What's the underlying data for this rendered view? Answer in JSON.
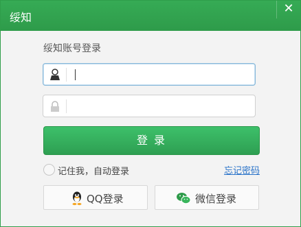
{
  "window": {
    "title": "绥知",
    "close_label": "✕"
  },
  "form": {
    "heading": "绥知账号登录",
    "username": {
      "value": "",
      "placeholder": ""
    },
    "password": {
      "value": "",
      "placeholder": ""
    },
    "login_label": "登 录",
    "remember_label": "记住我，自动登录",
    "forgot_label": "忘记密码"
  },
  "social": {
    "qq_label": "QQ登录",
    "wechat_label": "微信登录"
  },
  "colors": {
    "brand_green": "#2e9b4a",
    "link_blue": "#2a73c9",
    "icon_user": "#333333",
    "icon_lock": "#bbbbbb"
  }
}
